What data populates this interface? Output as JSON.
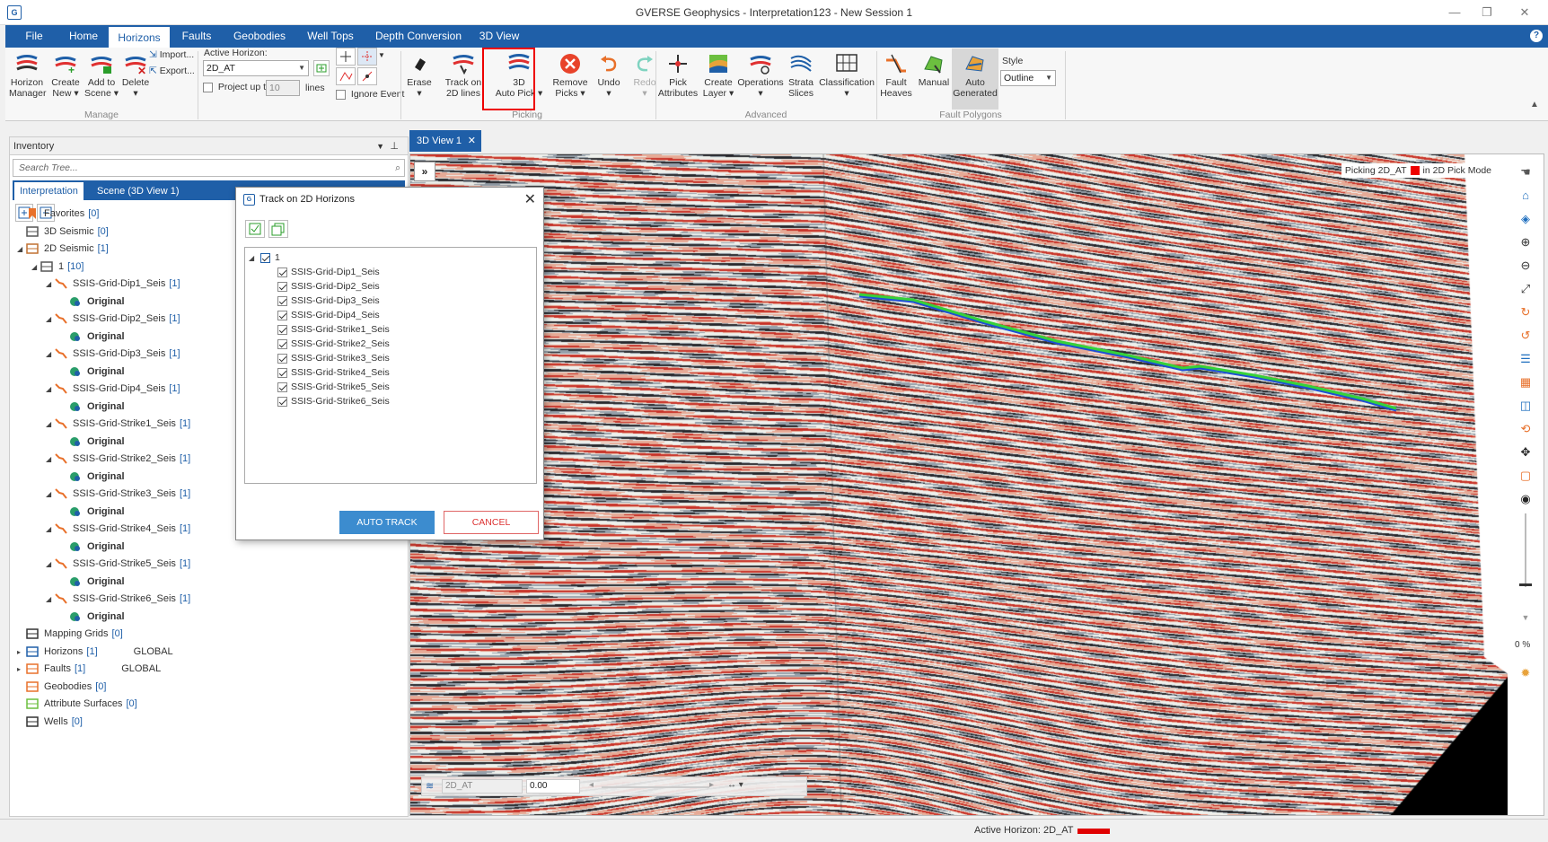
{
  "window": {
    "title": "GVERSE Geophysics - Interpretation123 - New Session 1",
    "icon_text": "G",
    "minimize": "—",
    "maximize": "❐",
    "close": "✕"
  },
  "menu": {
    "tabs": [
      "File",
      "Home",
      "Horizons",
      "Faults",
      "Geobodies",
      "Well Tops",
      "Depth Conversion",
      "3D View"
    ],
    "active": "Horizons",
    "help": "?"
  },
  "ribbon": {
    "manage": {
      "horizon_manager": [
        "Horizon",
        "Manager"
      ],
      "create_new": [
        "Create",
        "New ▾"
      ],
      "add_to_scene": [
        "Add to",
        "Scene ▾"
      ],
      "delete": [
        "Delete",
        "▾"
      ],
      "import": "Import...",
      "export": "Export...",
      "label": "Manage"
    },
    "active_horizon": {
      "label": "Active Horizon:",
      "value": "2D_AT",
      "project_label": "Project up to",
      "project_value": "10",
      "project_unit": "lines",
      "ignore_event": "Ignore Event"
    },
    "picking": {
      "erase": [
        "Erase",
        "▾"
      ],
      "track_2d": [
        "Track on",
        "2D lines"
      ],
      "auto_pick_3d": [
        "3D",
        "Auto Pick ▾"
      ],
      "remove_picks": [
        "Remove",
        "Picks ▾"
      ],
      "undo": [
        "Undo",
        "▾"
      ],
      "redo": [
        "Redo",
        "▾"
      ],
      "label": "Picking"
    },
    "advanced": {
      "pick_attributes": [
        "Pick",
        "Attributes"
      ],
      "create_layer": [
        "Create",
        "Layer ▾"
      ],
      "operations": [
        "Operations",
        "▾"
      ],
      "strata_slices": [
        "Strata",
        "Slices"
      ],
      "classification": [
        "Classification",
        "▾"
      ],
      "label": "Advanced"
    },
    "fault_polygons": {
      "fault_heaves": [
        "Fault",
        "Heaves"
      ],
      "manual": "Manual",
      "auto_generated": [
        "Auto",
        "Generated"
      ],
      "style_label": "Style",
      "style_value": "Outline",
      "label": "Fault Polygons"
    }
  },
  "inventory": {
    "title": "Inventory",
    "search_placeholder": "Search Tree...",
    "tabs": [
      "Interpretation",
      "Scene (3D View 1)"
    ],
    "tree": [
      {
        "label": "Favorites",
        "count": "[0]",
        "icon": "favorites-icon",
        "indent": 0,
        "exp": ""
      },
      {
        "label": "3D Seismic",
        "count": "[0]",
        "icon": "seismic3d-icon",
        "indent": 0,
        "exp": ""
      },
      {
        "label": "2D Seismic",
        "count": "[1]",
        "icon": "seismic2d-icon",
        "indent": 0,
        "exp": "◢"
      },
      {
        "label": "1",
        "count": "[10]",
        "icon": "survey-icon",
        "indent": 1,
        "exp": "◢"
      },
      {
        "label": "SSIS-Grid-Dip1_Seis",
        "count": "[1]",
        "icon": "line-icon",
        "indent": 2,
        "exp": "◢"
      },
      {
        "label": "Original",
        "count": "",
        "icon": "original-icon",
        "indent": 3,
        "exp": "",
        "bold": true
      },
      {
        "label": "SSIS-Grid-Dip2_Seis",
        "count": "[1]",
        "icon": "line-icon",
        "indent": 2,
        "exp": "◢"
      },
      {
        "label": "Original",
        "count": "",
        "icon": "original-icon",
        "indent": 3,
        "exp": "",
        "bold": true
      },
      {
        "label": "SSIS-Grid-Dip3_Seis",
        "count": "[1]",
        "icon": "line-icon",
        "indent": 2,
        "exp": "◢"
      },
      {
        "label": "Original",
        "count": "",
        "icon": "original-icon",
        "indent": 3,
        "exp": "",
        "bold": true
      },
      {
        "label": "SSIS-Grid-Dip4_Seis",
        "count": "[1]",
        "icon": "line-icon",
        "indent": 2,
        "exp": "◢"
      },
      {
        "label": "Original",
        "count": "",
        "icon": "original-icon",
        "indent": 3,
        "exp": "",
        "bold": true
      },
      {
        "label": "SSIS-Grid-Strike1_Seis",
        "count": "[1]",
        "icon": "line-icon",
        "indent": 2,
        "exp": "◢"
      },
      {
        "label": "Original",
        "count": "",
        "icon": "original-icon",
        "indent": 3,
        "exp": "",
        "bold": true
      },
      {
        "label": "SSIS-Grid-Strike2_Seis",
        "count": "[1]",
        "icon": "line-icon",
        "indent": 2,
        "exp": "◢"
      },
      {
        "label": "Original",
        "count": "",
        "icon": "original-icon",
        "indent": 3,
        "exp": "",
        "bold": true
      },
      {
        "label": "SSIS-Grid-Strike3_Seis",
        "count": "[1]",
        "icon": "line-icon",
        "indent": 2,
        "exp": "◢"
      },
      {
        "label": "Original",
        "count": "",
        "icon": "original-icon",
        "indent": 3,
        "exp": "",
        "bold": true
      },
      {
        "label": "SSIS-Grid-Strike4_Seis",
        "count": "[1]",
        "icon": "line-icon",
        "indent": 2,
        "exp": "◢"
      },
      {
        "label": "Original",
        "count": "",
        "icon": "original-icon",
        "indent": 3,
        "exp": "",
        "bold": true
      },
      {
        "label": "SSIS-Grid-Strike5_Seis",
        "count": "[1]",
        "icon": "line-icon",
        "indent": 2,
        "exp": "◢"
      },
      {
        "label": "Original",
        "count": "",
        "icon": "original-icon",
        "indent": 3,
        "exp": "",
        "bold": true
      },
      {
        "label": "SSIS-Grid-Strike6_Seis",
        "count": "[1]",
        "icon": "line-icon",
        "indent": 2,
        "exp": "◢"
      },
      {
        "label": "Original",
        "count": "",
        "icon": "original-icon",
        "indent": 3,
        "exp": "",
        "bold": true
      },
      {
        "label": "Mapping Grids",
        "count": "[0]",
        "icon": "grid-icon",
        "indent": 0,
        "exp": ""
      },
      {
        "label": "Horizons",
        "count": "[1]",
        "icon": "horizons-icon",
        "indent": 0,
        "exp": "▸",
        "extra": "GLOBAL"
      },
      {
        "label": "Faults",
        "count": "[1]",
        "icon": "faults-icon",
        "indent": 0,
        "exp": "▸",
        "extra": "GLOBAL"
      },
      {
        "label": "Geobodies",
        "count": "[0]",
        "icon": "geobodies-icon",
        "indent": 0,
        "exp": ""
      },
      {
        "label": "Attribute Surfaces",
        "count": "[0]",
        "icon": "attribute-icon",
        "indent": 0,
        "exp": ""
      },
      {
        "label": "Wells",
        "count": "[0]",
        "icon": "wells-icon",
        "indent": 0,
        "exp": ""
      }
    ]
  },
  "view": {
    "tab_label": "3D View 1",
    "tab_close": "✕",
    "expand": "»",
    "pick_status_prefix": "Picking 2D_AT",
    "pick_status_suffix": "in 2D Pick Mode",
    "zoom_pct": "0 %",
    "bottom_horizon": "2D_AT",
    "bottom_value": "0.00"
  },
  "dialog": {
    "title": "Track on 2D Horizons",
    "close": "✕",
    "root": "1",
    "lines": [
      "SSIS-Grid-Dip1_Seis",
      "SSIS-Grid-Dip2_Seis",
      "SSIS-Grid-Dip3_Seis",
      "SSIS-Grid-Dip4_Seis",
      "SSIS-Grid-Strike1_Seis",
      "SSIS-Grid-Strike2_Seis",
      "SSIS-Grid-Strike3_Seis",
      "SSIS-Grid-Strike4_Seis",
      "SSIS-Grid-Strike5_Seis",
      "SSIS-Grid-Strike6_Seis"
    ],
    "auto_track": "AUTO TRACK",
    "cancel": "CANCEL"
  },
  "status": {
    "text": "Active Horizon: 2D_AT",
    "horizon_color": "#e00000"
  },
  "colors": {
    "accent": "#1f5fa8",
    "pick_green": "#36d13a",
    "pick_blue": "#1d4fd6"
  }
}
